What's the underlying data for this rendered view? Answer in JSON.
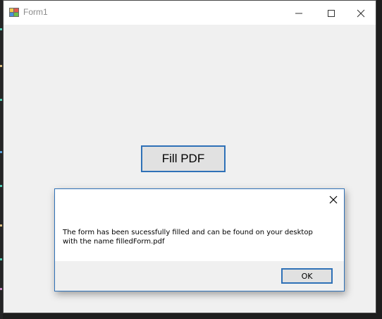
{
  "window": {
    "title": "Form1"
  },
  "main": {
    "fill_button_label": "Fill PDF"
  },
  "message_box": {
    "line1": "The form has been sucessfully filled and can be found on your desktop",
    "line2": "with the name filledForm.pdf",
    "ok_label": "OK"
  },
  "icons": {
    "app": "winforms-app-icon",
    "minimize": "minimize-icon",
    "maximize": "maximize-icon",
    "close": "close-icon",
    "dialog_close": "close-icon"
  },
  "colors": {
    "accent": "#2f71b7",
    "window_bg": "#f0f0f0",
    "button_bg": "#e1e1e1",
    "titlebar_bg": "#ffffff"
  }
}
